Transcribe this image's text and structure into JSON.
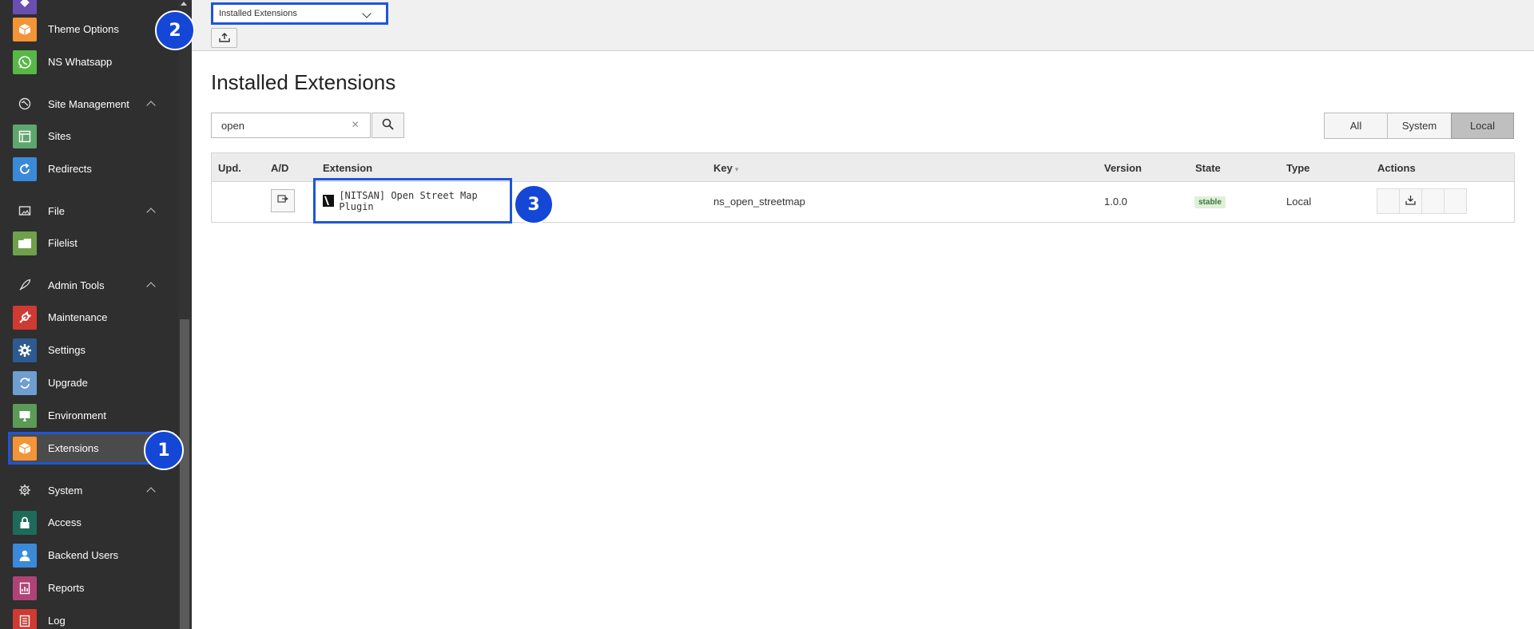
{
  "sidebar": {
    "items": [
      {
        "label": "Theme Options",
        "icon": "box-icon",
        "color": "#f29437"
      },
      {
        "label": "NS Whatsapp",
        "icon": "whatsapp-icon",
        "color": "#57b847"
      },
      {
        "label": "Sites",
        "icon": "sites-icon",
        "color": "#5ea66e"
      },
      {
        "label": "Redirects",
        "icon": "redirect-icon",
        "color": "#3b8ad8"
      },
      {
        "label": "Filelist",
        "icon": "folder-icon",
        "color": "#6fa04a"
      },
      {
        "label": "Maintenance",
        "icon": "wrench-icon",
        "color": "#cf3a32"
      },
      {
        "label": "Settings",
        "icon": "gear-icon",
        "color": "#2d5a90"
      },
      {
        "label": "Upgrade",
        "icon": "upgrade-icon",
        "color": "#6e9fd0"
      },
      {
        "label": "Environment",
        "icon": "environment-icon",
        "color": "#5b9a57"
      },
      {
        "label": "Extensions",
        "icon": "box-icon",
        "color": "#f29437"
      },
      {
        "label": "Access",
        "icon": "lock-icon",
        "color": "#1e6b5a"
      },
      {
        "label": "Backend Users",
        "icon": "user-icon",
        "color": "#3b8ad8"
      },
      {
        "label": "Reports",
        "icon": "reports-icon",
        "color": "#b04376"
      },
      {
        "label": "Log",
        "icon": "log-icon",
        "color": "#cf3a32"
      }
    ],
    "groups": [
      {
        "label": "Site Management",
        "icon": "globe-icon"
      },
      {
        "label": "File",
        "icon": "file-icon"
      },
      {
        "label": "Admin Tools",
        "icon": "rocket-icon"
      },
      {
        "label": "System",
        "icon": "gear-icon"
      }
    ]
  },
  "callouts": [
    "1",
    "2",
    "3"
  ],
  "topbar": {
    "module_select": "Installed Extensions",
    "upload_icon": "upload-icon"
  },
  "main": {
    "title": "Installed Extensions",
    "search": {
      "value": "open",
      "clear": "×"
    },
    "filters": [
      "All",
      "System",
      "Local"
    ],
    "active_filter": "Local"
  },
  "table": {
    "headers": [
      "Upd.",
      "A/D",
      "Extension",
      "Key",
      "Version",
      "State",
      "Type",
      "Actions"
    ],
    "rows": [
      {
        "extension": "[NITSAN] Open Street Map Plugin",
        "key": "ns_open_streetmap",
        "version": "1.0.0",
        "state": "stable",
        "type": "Local"
      }
    ]
  },
  "colors": {
    "sidebar_bg": "#2f2f2f",
    "highlight": "#1e56d8",
    "callout": "#1447d6"
  }
}
